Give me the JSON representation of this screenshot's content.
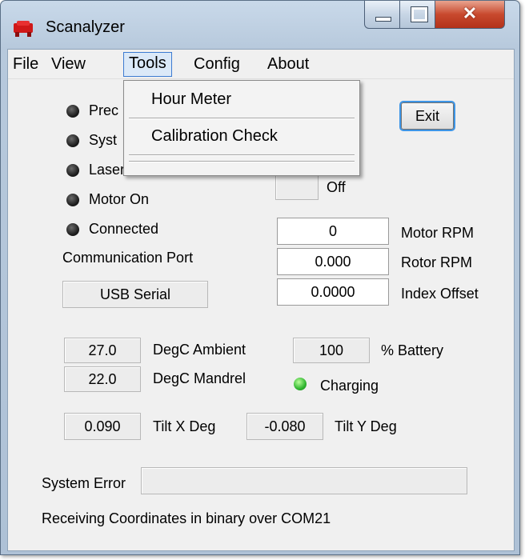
{
  "window": {
    "title": "Scanalyzer"
  },
  "titlebar_buttons": {
    "minimize": "minimize-icon",
    "maximize": "maximize-icon",
    "close": "close-icon"
  },
  "menubar": {
    "items": [
      "File",
      "View",
      "Tools",
      "Config",
      "About"
    ]
  },
  "tools_menu": {
    "items": [
      "Hour Meter",
      "Calibration Check"
    ]
  },
  "status_lights": [
    {
      "label": "Prec",
      "on": false
    },
    {
      "label": "Syst",
      "on": false
    },
    {
      "label": "Laser On",
      "on": false
    },
    {
      "label": "Motor On",
      "on": false
    },
    {
      "label": "Connected",
      "on": false
    }
  ],
  "exit_button": "Exit",
  "toggle": {
    "state": "Off"
  },
  "motor_rpm": {
    "value": "0",
    "label": "Motor RPM"
  },
  "rotor_rpm": {
    "value": "0.000",
    "label": "Rotor RPM"
  },
  "index_offset": {
    "value": "0.0000",
    "label": "Index Offset"
  },
  "comm": {
    "label": "Communication Port",
    "value": "USB Serial"
  },
  "ambient": {
    "value": "27.0",
    "label": "DegC Ambient"
  },
  "mandrel": {
    "value": "22.0",
    "label": "DegC Mandrel"
  },
  "battery": {
    "value": "100",
    "label": "% Battery"
  },
  "charging": {
    "label": "Charging",
    "on": true
  },
  "tilt_x": {
    "value": "0.090",
    "label": "Tilt X Deg"
  },
  "tilt_y": {
    "value": "-0.080",
    "label": "Tilt Y Deg"
  },
  "system_error": {
    "label": "System Error",
    "value": ""
  },
  "status_text": "Receiving Coordinates in binary over COM21"
}
